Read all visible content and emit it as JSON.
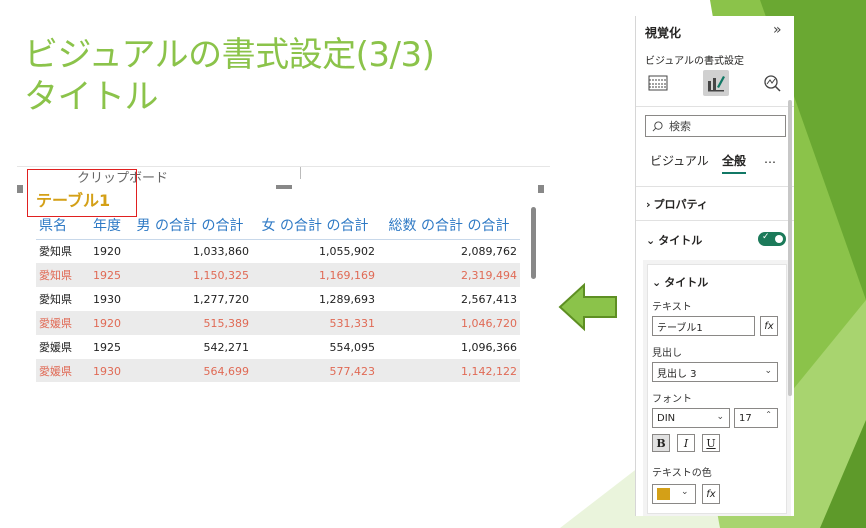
{
  "slide": {
    "title_line1": "ビジュアルの書式設定(3/3)",
    "title_line2": "タイトル"
  },
  "visual": {
    "ghost_text": "クリップボード",
    "title": "テーブル1",
    "columns": [
      "県名",
      "年度",
      "男 の合計 の合計",
      "女 の合計 の合計",
      "総数 の合計 の合計"
    ],
    "rows": [
      [
        "愛知県",
        "1920",
        "1,033,860",
        "1,055,902",
        "2,089,762"
      ],
      [
        "愛知県",
        "1925",
        "1,150,325",
        "1,169,169",
        "2,319,494"
      ],
      [
        "愛知県",
        "1930",
        "1,277,720",
        "1,289,693",
        "2,567,413"
      ],
      [
        "愛媛県",
        "1920",
        "515,389",
        "531,331",
        "1,046,720"
      ],
      [
        "愛媛県",
        "1925",
        "542,271",
        "554,095",
        "1,096,366"
      ],
      [
        "愛媛県",
        "1930",
        "564,699",
        "577,423",
        "1,142,122"
      ]
    ]
  },
  "panel": {
    "header": "視覚化",
    "collapse_icon": "»",
    "subheader": "ビジュアルの書式設定",
    "search_placeholder": "検索",
    "tabs": [
      "ビジュアル",
      "全般"
    ],
    "more": "…",
    "properties_label": "プロパティ",
    "title_section": "タイトル",
    "title_sub": "タイトル",
    "text_label": "テキスト",
    "text_value": "テーブル1",
    "fx": "fx",
    "heading_label": "見出し",
    "heading_value": "見出し 3",
    "font_label": "フォント",
    "font_family": "DIN",
    "font_size": "17",
    "bold": "B",
    "italic": "I",
    "underline": "U",
    "color_label": "テキストの色",
    "color_value": "#d4a017"
  },
  "colors": {
    "accent_green": "#8bc34a",
    "header_blue": "#2f7ac5",
    "alt_row_text": "#e06a55",
    "title_gold": "#d4a017",
    "toggle_green": "#1c7a5a"
  }
}
